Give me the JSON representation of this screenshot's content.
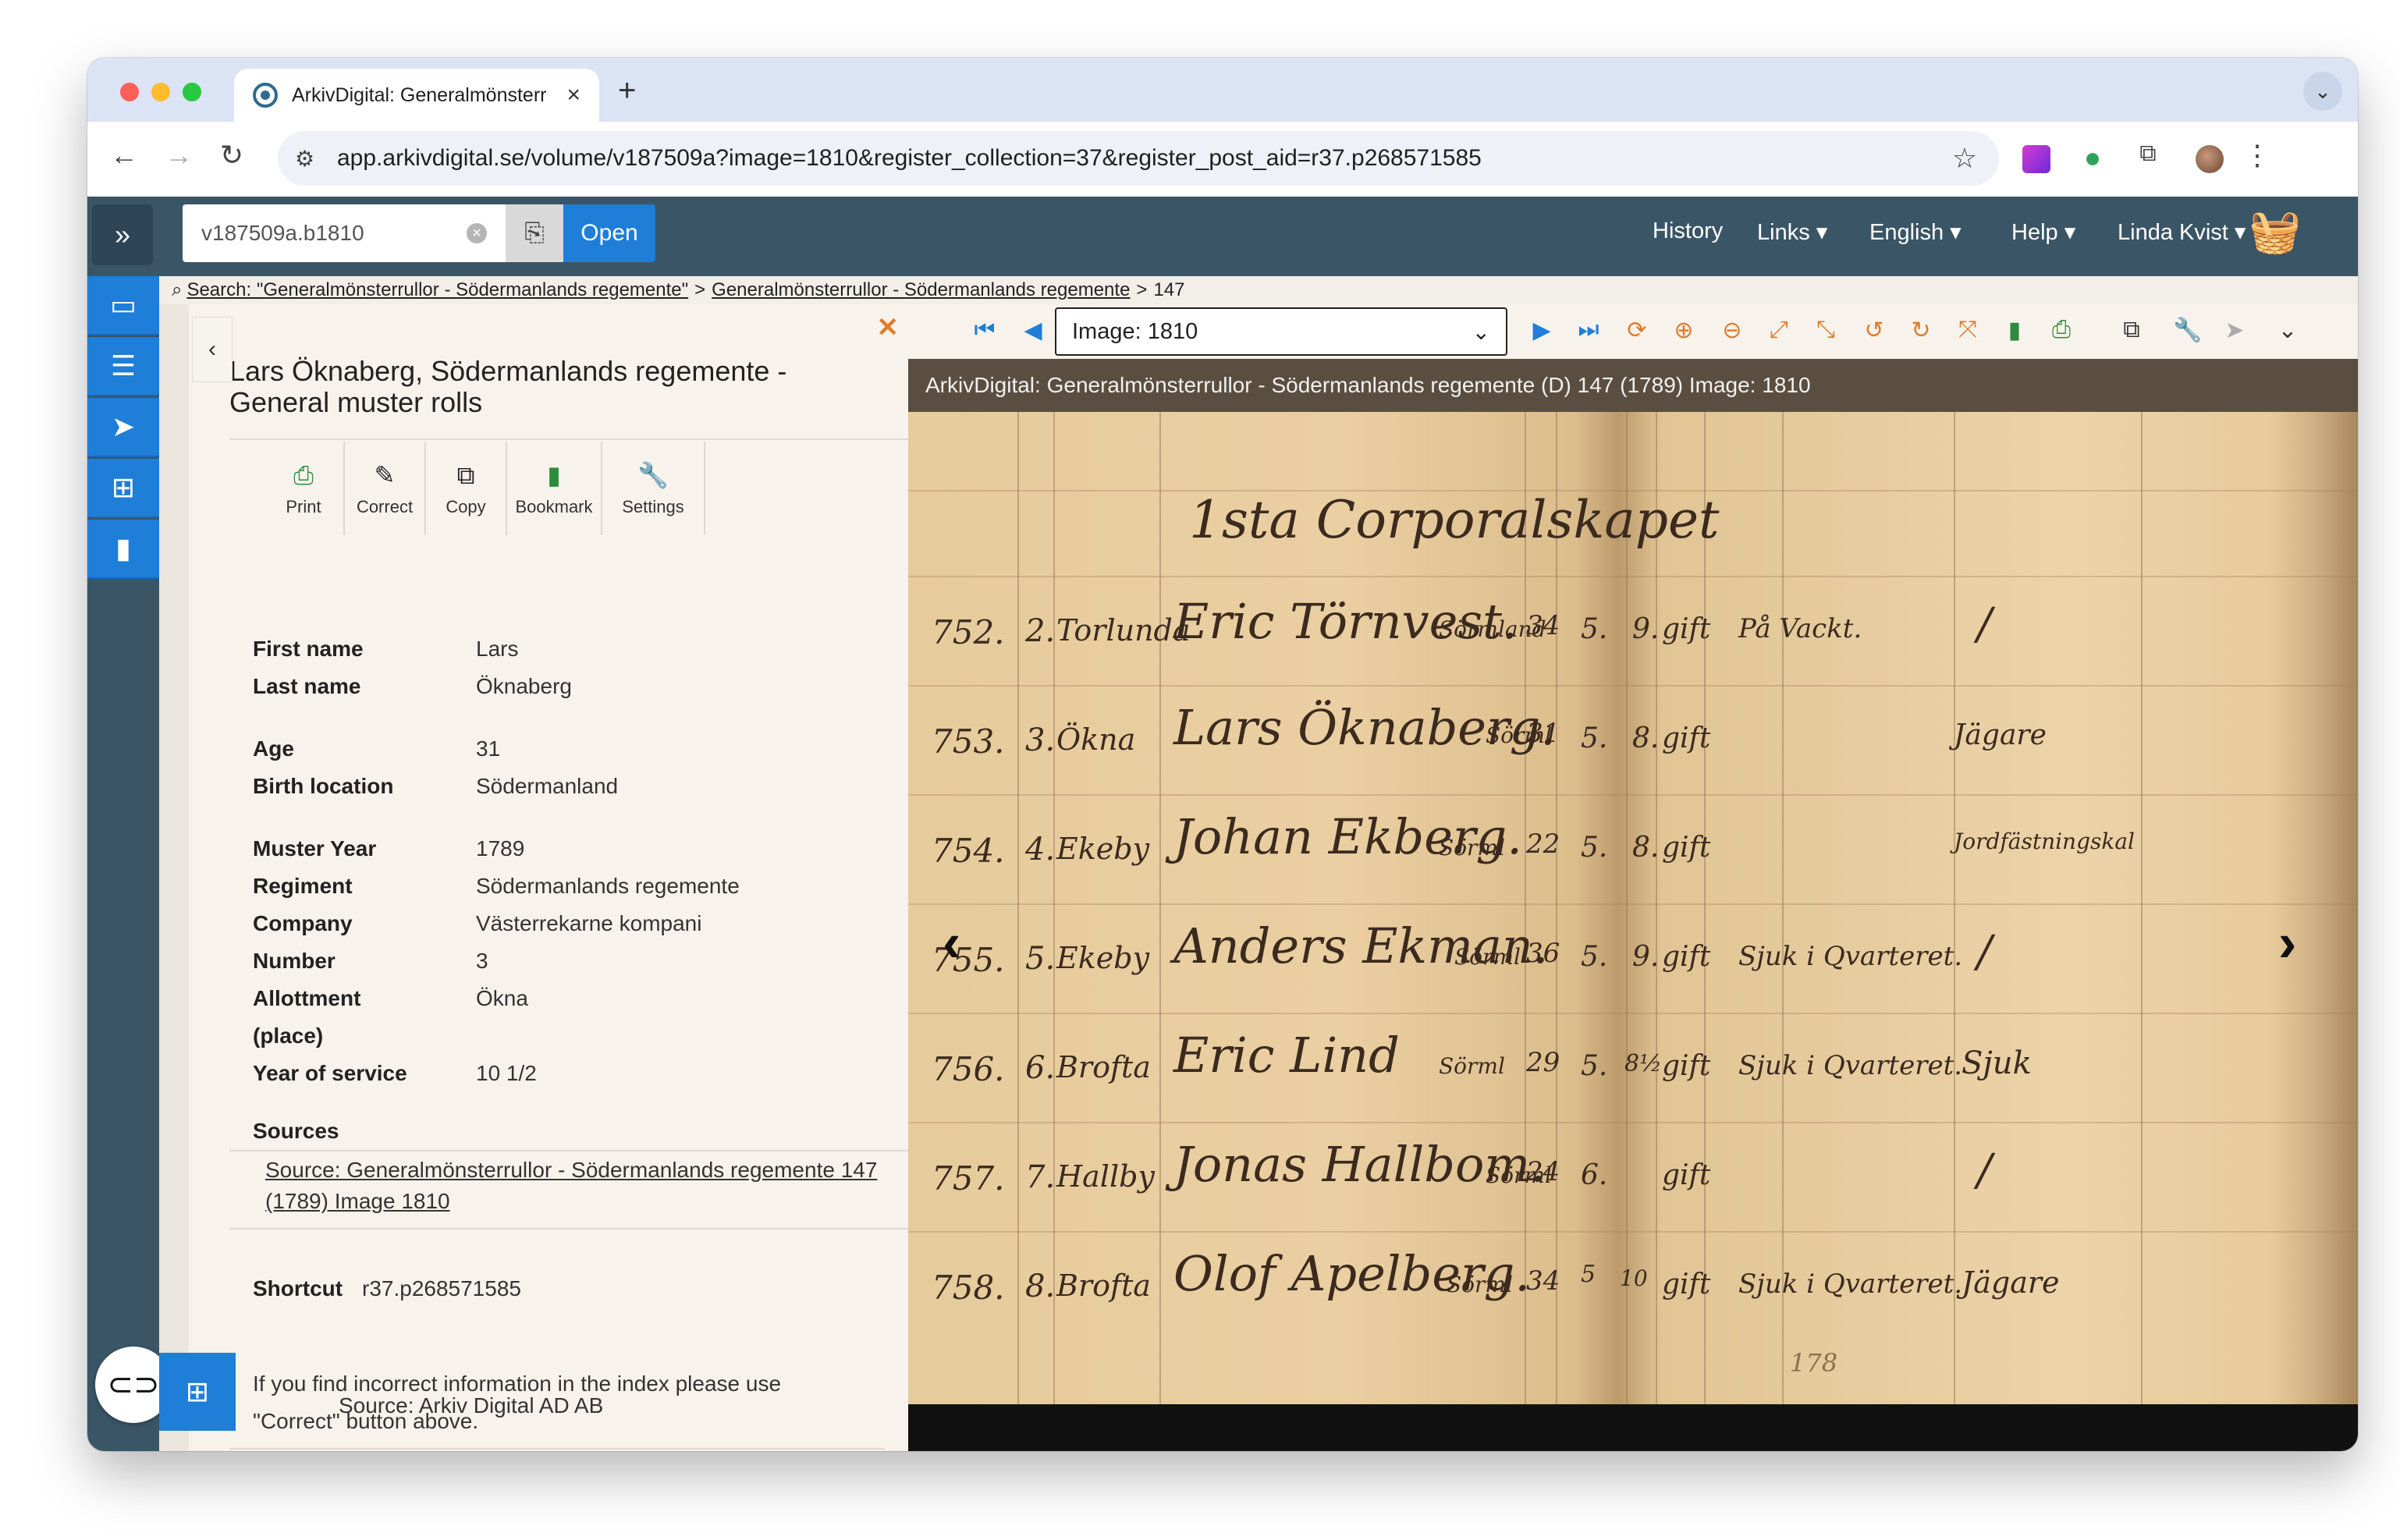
{
  "browser": {
    "tab_title": "ArkivDigital: Generalmönsterr",
    "url": "app.arkivdigital.se/volume/v187509a?image=1810&register_collection=37&register_post_aid=r37.p268571585"
  },
  "header": {
    "volume_input": "v187509a.b1810",
    "open_label": "Open",
    "nav": [
      "History",
      "Links",
      "English",
      "Help",
      "Linda Kvist"
    ]
  },
  "breadcrumb": {
    "search": "Search: \"Generalmönsterrullor - Södermanlands regemente\"",
    "sep1": ">",
    "collection": "Generalmönsterrullor - Södermanlands regemente",
    "sep2": ">",
    "volume": "147"
  },
  "panel": {
    "title": "Lars Öknaberg, Södermanlands regemente - General muster rolls",
    "actions": [
      "Print",
      "Correct",
      "Copy",
      "Bookmark",
      "Settings"
    ],
    "fields": [
      {
        "label": "First name",
        "value": "Lars"
      },
      {
        "label": "Last name",
        "value": "Öknaberg"
      },
      {
        "label": "Age",
        "value": "31"
      },
      {
        "label": "Birth location",
        "value": "Södermanland"
      },
      {
        "label": "Muster Year",
        "value": "1789"
      },
      {
        "label": "Regiment",
        "value": "Södermanlands regemente"
      },
      {
        "label": "Company",
        "value": "Västerrekarne kompani"
      },
      {
        "label": "Number",
        "value": "3"
      },
      {
        "label": "Allottment",
        "value": "Ökna"
      },
      {
        "label": "(place)",
        "value": ""
      },
      {
        "label": "Year of service",
        "value": "10 1/2"
      }
    ],
    "sources_heading": "Sources",
    "source_link": "Source: Generalmönsterrullor - Södermanlands regemente 147 (1789) Image 1810",
    "shortcut_label": "Shortcut",
    "shortcut_value": "r37.p268571585",
    "note": "If you find incorrect information in the index please use \"Correct\" button above.",
    "source_footer": "Source: Arkiv Digital AD AB"
  },
  "viewer": {
    "image_select": "Image: 1810",
    "caption": "ArkivDigital: Generalmönsterrullor - Södermanlands regemente (D) 147 (1789) Image: 1810"
  },
  "manuscript": {
    "heading": "1sta Corporalskapet",
    "rows": [
      {
        "num": "752.",
        "idx": "2.",
        "place": "Torlunda",
        "name": "Eric Törnvest.",
        "origin": "Sörmland",
        "age": "34",
        "col": "5.",
        "x": "9.",
        "status": "gift",
        "note": "På Vackt.",
        "mark": "/"
      },
      {
        "num": "753.",
        "idx": "3.",
        "place": "Ökna",
        "name": "Lars Öknaberg.",
        "origin": "Sörml",
        "age": "31",
        "col": "5.",
        "x": "8.",
        "status": "gift",
        "note": "",
        "mark": "Jägare"
      },
      {
        "num": "754.",
        "idx": "4.",
        "place": "Ekeby",
        "name": "Johan Ekberg.",
        "origin": "Sörml",
        "age": "22",
        "col": "5.",
        "x": "8.",
        "status": "gift",
        "note": "",
        "mark": "Jordfästningskal"
      },
      {
        "num": "755.",
        "idx": "5.",
        "place": "Ekeby",
        "name": "Anders Ekman.",
        "origin": "Sörml",
        "age": "36",
        "col": "5.",
        "x": "9.",
        "status": "gift",
        "note": "Sjuk i Qvarteret.",
        "mark": "/"
      },
      {
        "num": "756.",
        "idx": "6.",
        "place": "Brofta",
        "name": "Eric Lind",
        "origin": "Sörml",
        "age": "29",
        "col": "5.",
        "x": "8½",
        "status": "gift",
        "note": "Sjuk i Qvarteret.",
        "mark": "Sjuk"
      },
      {
        "num": "757.",
        "idx": "7.",
        "place": "Hallby",
        "name": "Jonas Hallbom.",
        "origin": "Sörml",
        "age": "24",
        "col": "6.",
        "x": "",
        "status": "gift",
        "note": "",
        "mark": "/"
      },
      {
        "num": "758.",
        "idx": "8.",
        "place": "Brofta",
        "name": "Olof Apelberg.",
        "origin": "Sörml",
        "age": "34",
        "col": "5",
        "x": "10",
        "status": "gift",
        "note": "Sjuk i Qvarteret.",
        "mark": "Jägare"
      }
    ],
    "page_number": "178"
  },
  "colors": {
    "header_bg": "#3a5566",
    "accent_blue": "#1e7ed8",
    "tool_orange": "#e07b2a",
    "panel_bg": "#f7f3ec"
  }
}
